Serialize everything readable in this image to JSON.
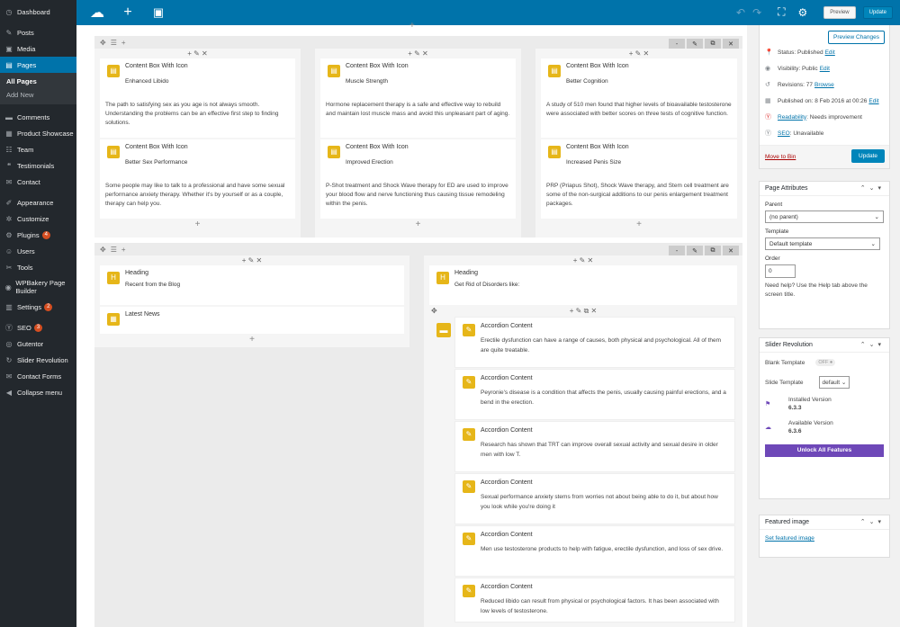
{
  "admin_menu": {
    "dashboard": "Dashboard",
    "posts": "Posts",
    "media": "Media",
    "pages": "Pages",
    "all_pages": "All Pages",
    "add_new": "Add New",
    "comments": "Comments",
    "product_showcase": "Product Showcase",
    "team": "Team",
    "testimonials": "Testimonials",
    "contact": "Contact",
    "appearance": "Appearance",
    "customize": "Customize",
    "plugins": "Plugins",
    "plugins_badge": "4",
    "users": "Users",
    "tools": "Tools",
    "wpbakery": "WPBakery Page Builder",
    "settings": "Settings",
    "settings_badge": "2",
    "seo": "SEO",
    "seo_badge": "3",
    "gutentor": "Gutentor",
    "slider_revolution": "Slider Revolution",
    "contact_forms": "Contact Forms",
    "collapse": "Collapse menu"
  },
  "topbar": {
    "preview": "Preview",
    "update": "Update"
  },
  "row1": {
    "col1": {
      "box1": {
        "title": "Content Box With Icon",
        "subtitle": "Enhanced Libido",
        "text": "The path to satisfying sex as you age is not always smooth. Understanding the problems can be an effective first step to finding solutions."
      },
      "box2": {
        "title": "Content Box With Icon",
        "subtitle": "Better Sex Performance",
        "text": "Some people may like to talk to a professional and have some sexual performance anxiety therapy. Whether it's by yourself or as a couple, therapy can help you."
      }
    },
    "col2": {
      "box1": {
        "title": "Content Box With Icon",
        "subtitle": "Muscle Strength",
        "text": "Hormone replacement therapy is a safe and effective way to rebuild and maintain lost muscle mass and avoid this unpleasant part of aging."
      },
      "box2": {
        "title": "Content Box With Icon",
        "subtitle": "Improved Erection",
        "text": "P-Shot treatment and Shock Wave therapy for ED are used to improve your blood flow and nerve functioning thus causing tissue remodeling within the penis."
      }
    },
    "col3": {
      "box1": {
        "title": "Content Box With Icon",
        "subtitle": "Better Cognition",
        "text": "A study of 510 men found that higher levels of bioavailable testosterone were associated with better scores on three tests of cognitive function."
      },
      "box2": {
        "title": "Content Box With Icon",
        "subtitle": "Increased Penis Size",
        "text": "PRP (Priapus Shot), Shock Wave therapy, and Stem cell treatment are some of the non-surgical additions to our penis enlargement treatment packages."
      }
    }
  },
  "row2": {
    "left": {
      "heading": {
        "title": "Heading",
        "subtitle": "Recent from the Blog"
      },
      "news": {
        "title": "Latest News"
      }
    },
    "right": {
      "heading": {
        "title": "Heading",
        "subtitle": "Get Rid of Disorders like:"
      },
      "accordion": [
        {
          "title": "Accordion Content",
          "text": "Erectile dysfunction can have a range of causes, both physical and psychological. All of them are quite treatable."
        },
        {
          "title": "Accordion Content",
          "text": "Peyronie's disease is a condition that affects the penis, usually causing painful erections, and a bend in the erection."
        },
        {
          "title": "Accordion Content",
          "text": "Research has shown that TRT can improve overall sexual activity and sexual desire in older men with low T."
        },
        {
          "title": "Accordion Content",
          "text": "Sexual performance anxiety stems from worries not about being able to do it, but about how you look while you're doing it"
        },
        {
          "title": "Accordion Content",
          "text": "Men use testosterone products to help with fatigue, erectile dysfunction, and loss of sex drive."
        },
        {
          "title": "Accordion Content",
          "text": "Reduced libido can result from physical or psychological factors. It has been associated with low levels of testosterone."
        }
      ]
    }
  },
  "publish": {
    "preview_changes": "Preview Changes",
    "status_label": "Status: Published",
    "status_edit": "Edit",
    "visibility_label": "Visibility: Public",
    "visibility_edit": "Edit",
    "revisions_label": "Revisions: 77",
    "revisions_browse": "Browse",
    "published_label": "Published on: 8 Feb 2016 at 00:26",
    "published_edit": "Edit",
    "readability_link": "Readability",
    "readability_value": ": Needs improvement",
    "seo_link": "SEO",
    "seo_value": ": Unavailable",
    "move_to_bin": "Move to Bin",
    "update": "Update"
  },
  "page_attributes": {
    "title": "Page Attributes",
    "parent_label": "Parent",
    "parent_value": "(no parent)",
    "template_label": "Template",
    "template_value": "Default template",
    "order_label": "Order",
    "order_value": "0",
    "help": "Need help? Use the Help tab above the screen title."
  },
  "slider_revolution": {
    "title": "Slider Revolution",
    "blank_template": "Blank Template",
    "toggle_state": "OFF",
    "slide_template": "Slide Template",
    "slide_template_value": "default",
    "installed_label": "Installed Version",
    "installed_version": "6.3.3",
    "available_label": "Available Version",
    "available_version": "6.3.6",
    "unlock": "Unlock All Features"
  },
  "featured_image": {
    "title": "Featured image",
    "link": "Set featured image"
  },
  "colors": {
    "admin_bg": "#23282d",
    "accent": "#0073aa",
    "element_icon": "#e6b619",
    "unlock_purple": "#6e48b8"
  }
}
